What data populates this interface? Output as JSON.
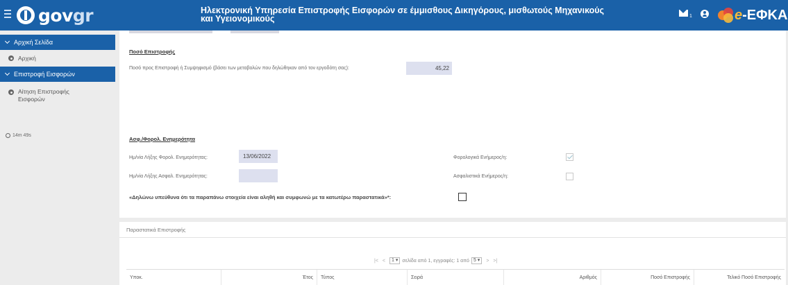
{
  "header": {
    "logo_gov": "gov",
    "logo_gr": "gr",
    "title_line1": "Ηλεκτρονική Υπηρεσία Επιστροφής Εισφορών σε έμμισθους Δικηγόρους, μισθωτούς Μηχανικούς",
    "title_line2": "και Υγειονομικούς",
    "mail_count": "1",
    "efka_prefix": "e",
    "efka_text": "-ΕΦΚΑ",
    "brand_color": "#1a61a8"
  },
  "sidebar": {
    "groups": [
      {
        "label": "Αρχική Σελίδα",
        "items": [
          {
            "label": "Αρχική",
            "icon": "gear-icon"
          }
        ]
      },
      {
        "label": "Επιστροφή Εισφορών",
        "items": [
          {
            "label_line1": "Αίτηση Επιστροφής",
            "label_line2": "Εισφορών",
            "icon": "gear-icon"
          }
        ]
      }
    ],
    "timer": "14m 49s"
  },
  "main": {
    "refund": {
      "title": "Ποσό Επιστροφής",
      "label": "Ποσό προς Επιστροφή ή Συμψηφισμό (βάσει των μεταβολών που δηλώθηκαν από τον εργοδότη σας):",
      "value": "45,22"
    },
    "compliance": {
      "title": "Ασφ./Φορολ. Ενημερότητα",
      "tax_date_label": "Ημ/νία Λήξης Φορολ. Ενημερότητας:",
      "tax_date_value": "13/06/2022",
      "ins_date_label": "Ημ/νία Λήξης Ασφαλ. Ενημερότητας:",
      "ins_date_value": "",
      "tax_ok_label": "Φορολογικά Ενήμερος/η:",
      "tax_ok_checked": true,
      "ins_ok_label": "Ασφαλιστικά Ενήμερος/η:",
      "ins_ok_checked": false,
      "declaration": "«Δηλώνω υπεύθυνα ότι τα παραπάνω στοιχεία είναι αληθή και συμφωνώ με τα κατωτέρω παραστατικά»*:",
      "declaration_checked": false
    },
    "documents": {
      "title": "Παραστατικά Επιστροφής",
      "pager": {
        "first": "|<",
        "prev": "<",
        "page_value": "1",
        "text_middle": "σελίδα από 1, εγγραφές: 1 από",
        "page_size": "5",
        "next": ">",
        "last": ">|"
      },
      "columns": [
        "Υποκ.",
        "Έτος",
        "Τύπος",
        "Σειρά",
        "Αριθμός",
        "Ποσό Επιστροφής",
        "Τελικό Ποσό Επιστροφής"
      ]
    }
  }
}
